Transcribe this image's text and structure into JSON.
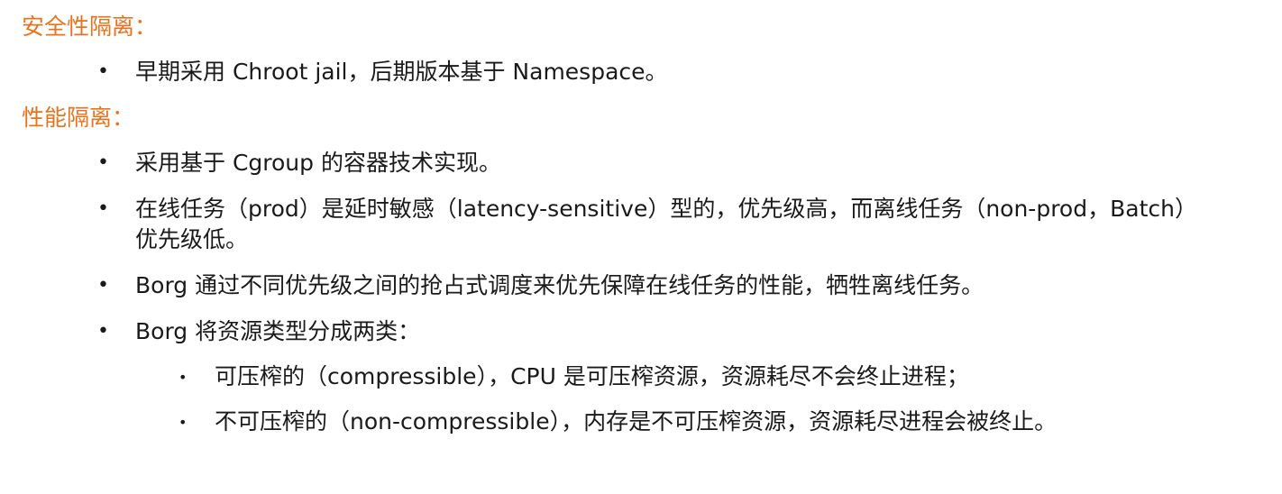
{
  "sections": [
    {
      "heading": "安全性隔离：",
      "items": [
        {
          "text": "早期采用 Chroot jail，后期版本基于 Namespace。"
        }
      ]
    },
    {
      "heading": "性能隔离：",
      "items": [
        {
          "text": "采用基于 Cgroup 的容器技术实现。"
        },
        {
          "text": "在线任务（prod）是延时敏感（latency-sensitive）型的，优先级高，而离线任务（non-prod，Batch）优先级低。"
        },
        {
          "text": "Borg 通过不同优先级之间的抢占式调度来优先保障在线任务的性能，牺牲离线任务。"
        },
        {
          "text": "Borg 将资源类型分成两类：",
          "subitems": [
            {
              "text": "可压榨的（compressible），CPU 是可压榨资源，资源耗尽不会终止进程；"
            },
            {
              "text": "不可压榨的（non-compressible），内存是不可压榨资源，资源耗尽进程会被终止。"
            }
          ]
        }
      ]
    }
  ],
  "bullet_glyph": "•",
  "colors": {
    "heading": "#e8731e",
    "body": "#1a1a1a"
  }
}
